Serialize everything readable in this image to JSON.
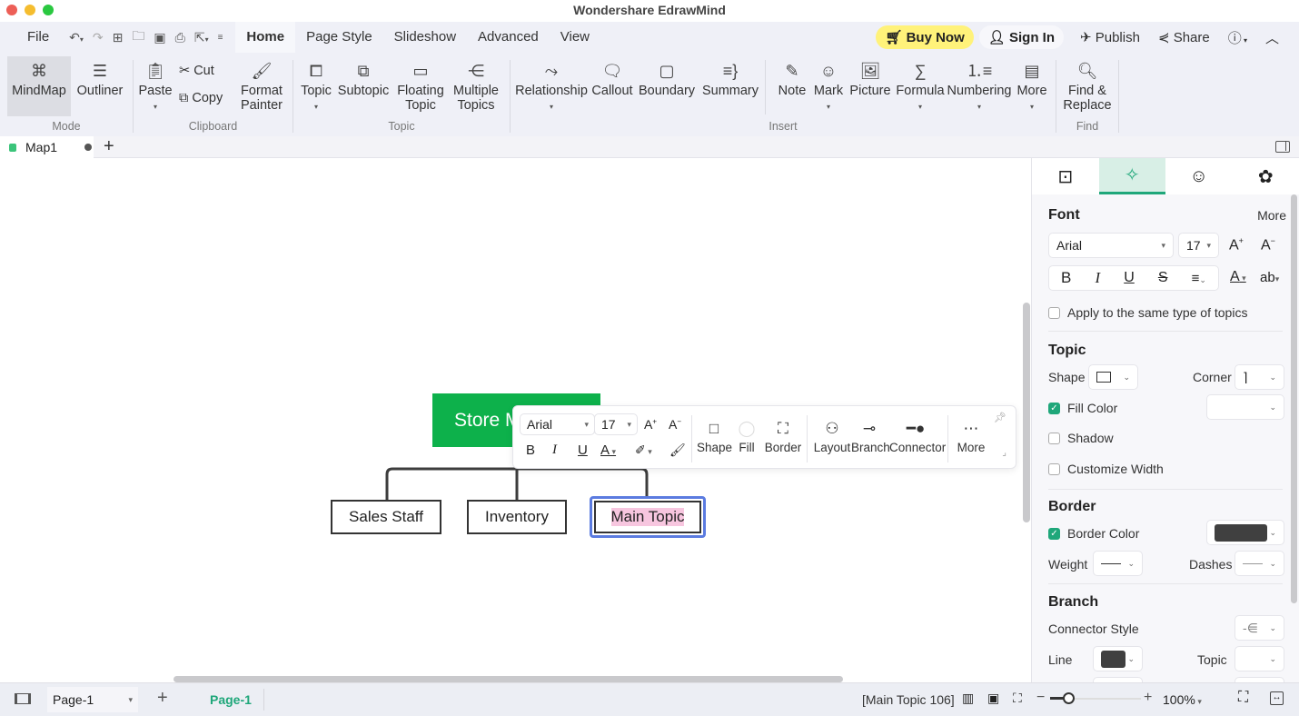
{
  "window": {
    "title": "Wondershare EdrawMind"
  },
  "menubar": {
    "file": "File",
    "tabs": [
      "Home",
      "Page Style",
      "Slideshow",
      "Advanced",
      "View"
    ],
    "active_tab": "Home",
    "buy_now": "Buy Now",
    "sign_in": "Sign In",
    "publish": "Publish",
    "share": "Share"
  },
  "ribbon": {
    "mode": {
      "label": "Mode",
      "mindmap": "MindMap",
      "outliner": "Outliner"
    },
    "clipboard": {
      "label": "Clipboard",
      "paste": "Paste",
      "cut": "Cut",
      "copy": "Copy",
      "format_painter_1": "Format",
      "format_painter_2": "Painter"
    },
    "topic": {
      "label": "Topic",
      "topic": "Topic",
      "subtopic": "Subtopic",
      "floating_1": "Floating",
      "floating_2": "Topic",
      "multiple_1": "Multiple",
      "multiple_2": "Topics"
    },
    "insert": {
      "label": "Insert",
      "relationship": "Relationship",
      "callout": "Callout",
      "boundary": "Boundary",
      "summary": "Summary",
      "note": "Note",
      "mark": "Mark",
      "picture": "Picture",
      "formula": "Formula",
      "numbering": "Numbering",
      "more": "More"
    },
    "find": {
      "label": "Find",
      "find_1": "Find &",
      "find_2": "Replace"
    }
  },
  "doc_tabs": {
    "current": "Map1",
    "add": "+"
  },
  "canvas": {
    "root": {
      "text": "Store M",
      "color": "#0db14b"
    },
    "topics": [
      "Sales Staff",
      "Inventory",
      "Main Topic"
    ],
    "selected_topic": "Main Topic",
    "selection_color": "#5b7be0",
    "text_highlight": "#f7c6df"
  },
  "floating_toolbar": {
    "font": "Arial",
    "size": "17",
    "shape": "Shape",
    "fill": "Fill",
    "border": "Border",
    "layout": "Layout",
    "branch": "Branch",
    "connector": "Connector",
    "more": "More"
  },
  "panel": {
    "font": {
      "heading": "Font",
      "more": "More",
      "family": "Arial",
      "size": "17",
      "apply_same": "Apply to the same type of topics",
      "apply_same_checked": false
    },
    "topic": {
      "heading": "Topic",
      "shape_label": "Shape",
      "corner_label": "Corner",
      "fill_color": "Fill Color",
      "fill_color_checked": true,
      "shadow": "Shadow",
      "shadow_checked": false,
      "customize_width": "Customize Width",
      "customize_width_checked": false
    },
    "border": {
      "heading": "Border",
      "border_color": "Border Color",
      "border_color_checked": true,
      "border_color_value": "#404040",
      "weight": "Weight",
      "dashes": "Dashes"
    },
    "branch": {
      "heading": "Branch",
      "connector_style": "Connector Style",
      "line": "Line",
      "line_color": "#404040",
      "topic": "Topic"
    },
    "accent": "#1fa77a"
  },
  "statusbar": {
    "page_select": "Page-1",
    "active_page": "Page-1",
    "selection_info": "[Main Topic 106]",
    "zoom": "100%",
    "zoom_fraction": 0.2
  }
}
